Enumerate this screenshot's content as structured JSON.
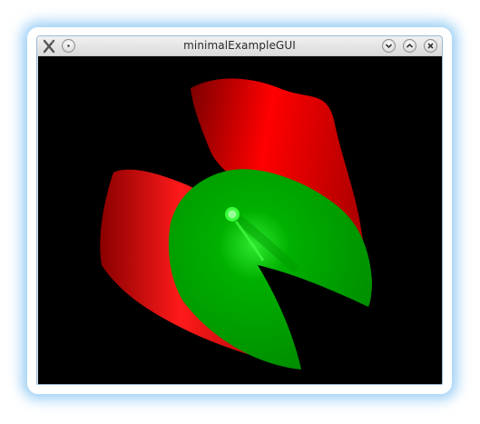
{
  "window": {
    "title": "minimalExampleGUI",
    "app_icon": "x-tools-icon",
    "left_button_icon": "menu-dot-icon",
    "buttons": [
      {
        "name": "minimize-button",
        "icon": "chevron-down-icon"
      },
      {
        "name": "maximize-button",
        "icon": "chevron-up-icon"
      },
      {
        "name": "close-button",
        "icon": "close-icon"
      }
    ]
  },
  "viewport": {
    "background": "#000000",
    "surface_outer_color": "#ff0000",
    "surface_inner_color": "#00b000"
  }
}
